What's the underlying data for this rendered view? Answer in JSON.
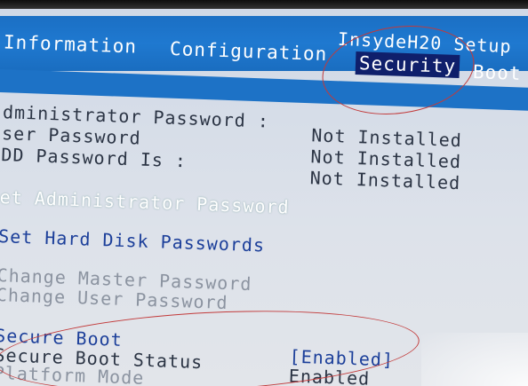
{
  "header": {
    "title": "InsydeH20 Setup"
  },
  "tabs": [
    {
      "label": "Information"
    },
    {
      "label": "Configuration"
    },
    {
      "label": "Security"
    },
    {
      "label": "Boot"
    }
  ],
  "security": {
    "admin_password_label": "dministrator Password :",
    "admin_password_value": "Not Installed",
    "user_password_label": "ser Password",
    "user_password_value": "Not Installed",
    "hdd_password_label": "DD Password Is :",
    "hdd_password_value": "Not Installed",
    "set_admin_password": "et Administrator Password",
    "set_hdd_passwords": "Set Hard Disk Passwords",
    "change_master_password": "Change Master Password",
    "change_user_password": "Change User Password",
    "secure_boot_label": "Secure Boot",
    "secure_boot_value": "[Enabled]",
    "secure_boot_status_label": "Secure Boot Status",
    "secure_boot_status_value": "Enabled",
    "platform_mode_label": "Platform Mode"
  },
  "colors": {
    "menubar": "#1d72c6",
    "selected_tab": "#0f1f6b",
    "annotation_ring": "#c23a3a"
  }
}
